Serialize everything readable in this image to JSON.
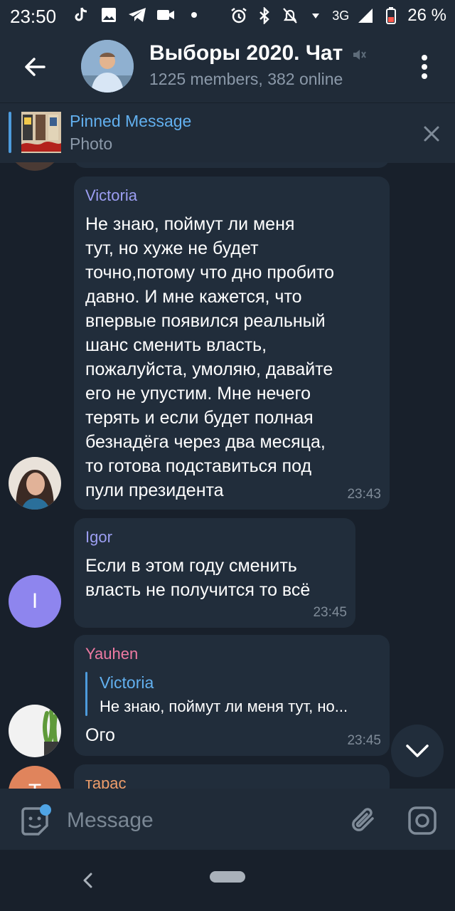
{
  "status_bar": {
    "time": "23:50",
    "network": "3G",
    "battery": "26 %",
    "icons": [
      "tiktok-icon",
      "gallery-icon",
      "telegram-icon",
      "video-icon",
      "dot-icon",
      "alarm-icon",
      "bluetooth-icon",
      "mute-bell-icon",
      "wifi-icon",
      "signal-icon",
      "battery-icon"
    ]
  },
  "header": {
    "title": "Выборы 2020. Чат",
    "subtitle": "1225 members, 382 online",
    "icons": [
      "back-arrow-icon",
      "muted-icon",
      "more-vert-icon"
    ]
  },
  "pinned": {
    "title": "Pinned Message",
    "subtitle": "Photo"
  },
  "messages": [
    {
      "sender": "Victoria",
      "sender_color": "#9c9ef2",
      "lines": [
        "Не знаю, поймут ли меня",
        "тут, но хуже не будет",
        "точно,потому что дно пробито",
        "давно. И мне кажется, что",
        "впервые появился реальный",
        "шанс сменить власть,",
        "пожалуйста, умоляю, давайте",
        "его не упустим. Мне нечего",
        "терять и если будет полная",
        "безнадёга через два месяца,",
        "то готова подставиться под",
        "пули президента"
      ],
      "time": "23:43"
    },
    {
      "sender": "Igor",
      "sender_color": "#9c9ef2",
      "avatar_letter": "I",
      "avatar_color": "#8e85ee",
      "lines": [
        "Если в этом году сменить",
        "власть не получится то всё"
      ],
      "time": "23:45"
    },
    {
      "sender": "Yauhen",
      "sender_color": "#ee7aa2",
      "reply": {
        "name": "Victoria",
        "text": "Не знаю, поймут ли меня тут, но..."
      },
      "text": "Ого",
      "time": "23:45"
    },
    {
      "sender": "тарас",
      "sender_color": "#ee9d6a",
      "avatar_letter": "Т",
      "avatar_color": "#e0845c"
    }
  ],
  "input": {
    "placeholder": "Message"
  },
  "colors": {
    "background": "#18202b",
    "bubble": "#212d3b",
    "header": "#202b38",
    "accent": "#62b0ef"
  }
}
